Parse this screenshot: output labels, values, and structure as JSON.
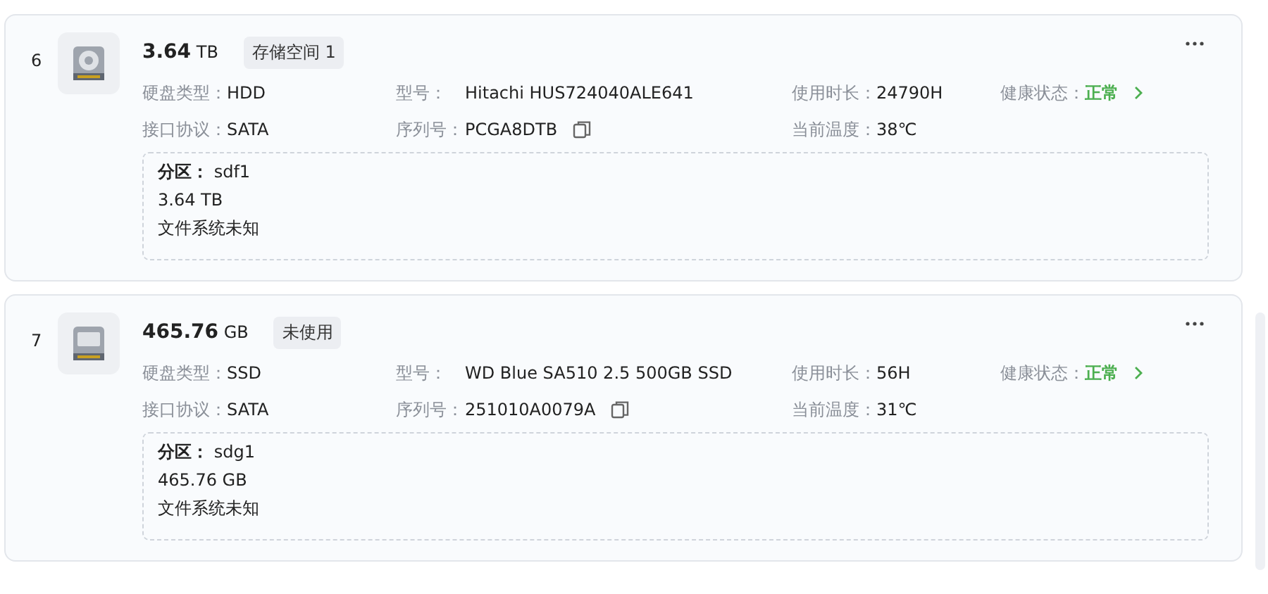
{
  "disks": [
    {
      "index": "6",
      "kind": "hdd",
      "size": "3.64",
      "unit": "TB",
      "tag": "存储空间 1",
      "fields": [
        {
          "label": "硬盘类型：",
          "value": "HDD"
        },
        {
          "label": "型号：",
          "value": "Hitachi HUS724040ALE641"
        },
        {
          "label": "使用时长：",
          "value": "24790H"
        },
        {
          "label": "健康状态：",
          "value": "正常",
          "kind": "health"
        },
        {
          "label": "接口协议：",
          "value": "SATA"
        },
        {
          "label": "序列号：",
          "value": "PCGA8DTB",
          "kind": "copy"
        },
        {
          "label": "当前温度：",
          "value": "38℃"
        }
      ],
      "partition": {
        "label": "分区：",
        "name": "sdf1",
        "size": "3.64 TB",
        "filesystem": "文件系统未知"
      }
    },
    {
      "index": "7",
      "kind": "ssd",
      "size": "465.76",
      "unit": "GB",
      "tag": "未使用",
      "fields": [
        {
          "label": "硬盘类型：",
          "value": "SSD"
        },
        {
          "label": "型号：",
          "value": "WD Blue SA510 2.5 500GB SSD"
        },
        {
          "label": "使用时长：",
          "value": "56H"
        },
        {
          "label": "健康状态：",
          "value": "正常",
          "kind": "health"
        },
        {
          "label": "接口协议：",
          "value": "SATA"
        },
        {
          "label": "序列号：",
          "value": "251010A0079A",
          "kind": "copy"
        },
        {
          "label": "当前温度：",
          "value": "31℃"
        }
      ],
      "partition": {
        "label": "分区：",
        "name": "sdg1",
        "size": "465.76 GB",
        "filesystem": "文件系统未知"
      }
    }
  ]
}
